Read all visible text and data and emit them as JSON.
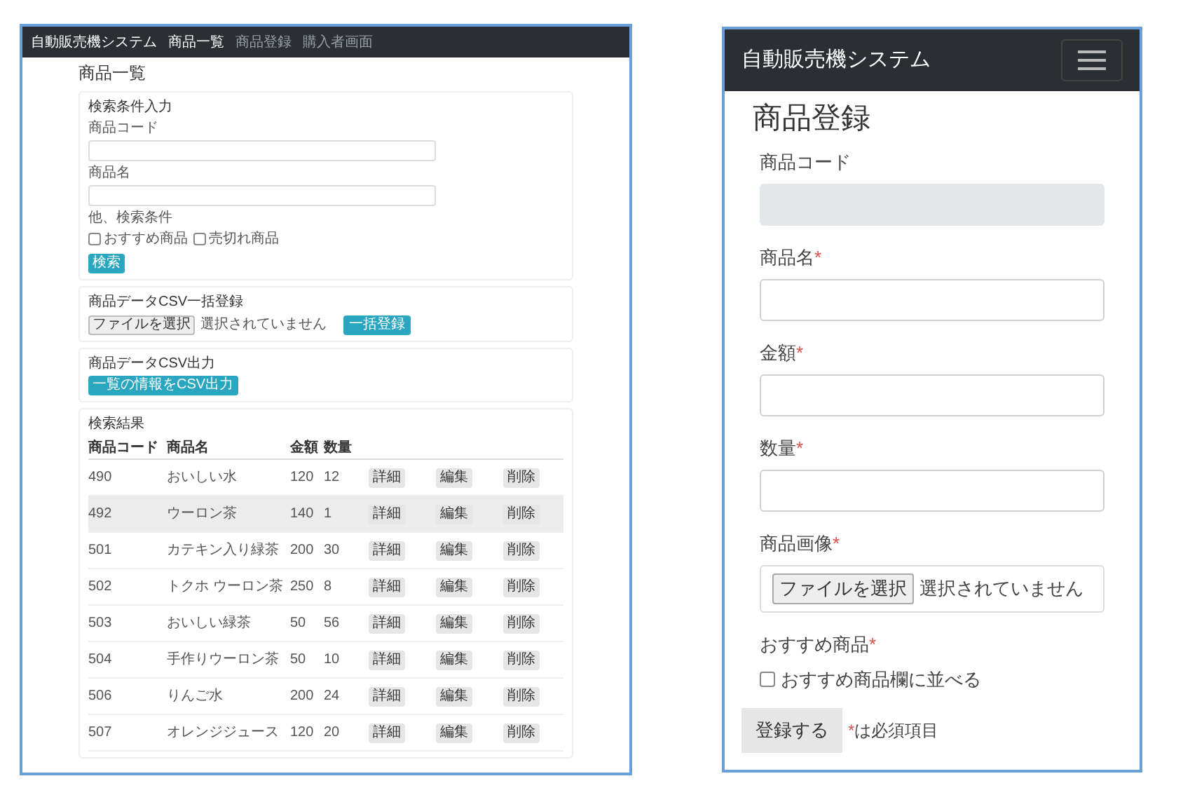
{
  "list_screen": {
    "navbar": {
      "brand": "自動販売機システム",
      "links": [
        {
          "label": "商品一覧",
          "selected": true
        },
        {
          "label": "商品登録",
          "selected": false
        },
        {
          "label": "購入者画面",
          "selected": false
        }
      ]
    },
    "title": "商品一覧",
    "search": {
      "heading": "検索条件入力",
      "fields": [
        {
          "label": "商品コード"
        },
        {
          "label": "商品名"
        }
      ],
      "options_label": "他、検索条件",
      "options": [
        {
          "label": "おすすめ商品",
          "checked": false
        },
        {
          "label": "売切れ商品",
          "checked": false
        }
      ],
      "button": "検索"
    },
    "csv_import": {
      "heading": "商品データCSV一括登録",
      "file_button": "ファイルを選択",
      "file_status": "選択されていません",
      "button": "一括登録"
    },
    "csv_export": {
      "heading": "商品データCSV出力",
      "button": "一覧の情報をCSV出力"
    },
    "results": {
      "heading": "検索結果",
      "columns": [
        "商品コード",
        "商品名",
        "金額",
        "数量"
      ],
      "rows": [
        {
          "cells": [
            "490",
            "おいしい水",
            "120",
            "12"
          ],
          "highlighted": false,
          "actions": [
            "詳細",
            "編集",
            "削除"
          ]
        },
        {
          "cells": [
            "492",
            "ウーロン茶",
            "140",
            "1"
          ],
          "highlighted": true,
          "actions": [
            "詳細",
            "編集",
            "削除"
          ]
        },
        {
          "cells": [
            "501",
            "カテキン入り緑茶",
            "200",
            "30"
          ],
          "highlighted": false,
          "actions": [
            "詳細",
            "編集",
            "削除"
          ]
        },
        {
          "cells": [
            "502",
            "トクホ ウーロン茶",
            "250",
            "8"
          ],
          "highlighted": false,
          "actions": [
            "詳細",
            "編集",
            "削除"
          ]
        },
        {
          "cells": [
            "503",
            "おいしい緑茶",
            "50",
            "56"
          ],
          "highlighted": false,
          "actions": [
            "詳細",
            "編集",
            "削除"
          ]
        },
        {
          "cells": [
            "504",
            "手作りウーロン茶",
            "50",
            "10"
          ],
          "highlighted": false,
          "actions": [
            "詳細",
            "編集",
            "削除"
          ]
        },
        {
          "cells": [
            "506",
            "りんご水",
            "200",
            "24"
          ],
          "highlighted": false,
          "actions": [
            "詳細",
            "編集",
            "削除"
          ]
        },
        {
          "cells": [
            "507",
            "オレンジジュース",
            "120",
            "20"
          ],
          "highlighted": false,
          "actions": [
            "詳細",
            "編集",
            "削除"
          ]
        }
      ]
    }
  },
  "register_screen": {
    "navbar": {
      "brand": "自動販売機システム"
    },
    "title": "商品登録",
    "fields": [
      {
        "kind": "text",
        "label": "商品コード",
        "disabled": true
      },
      {
        "kind": "text",
        "label": "商品名",
        "required_mark": "*",
        "disabled": false
      },
      {
        "kind": "text",
        "label": "金額",
        "required_mark": "*",
        "disabled": false
      },
      {
        "kind": "text",
        "label": "数量",
        "required_mark": "*",
        "disabled": false
      },
      {
        "kind": "file",
        "label": "商品画像",
        "required_mark": "*",
        "file_button": "ファイルを選択",
        "file_status": "選択されていません"
      },
      {
        "kind": "checkbox",
        "label": "おすすめ商品",
        "required_mark": "*",
        "option": "おすすめ商品欄に並べる",
        "checked": false
      }
    ],
    "submit": "登録する",
    "note_mark": "*",
    "note": "は必須項目"
  }
}
